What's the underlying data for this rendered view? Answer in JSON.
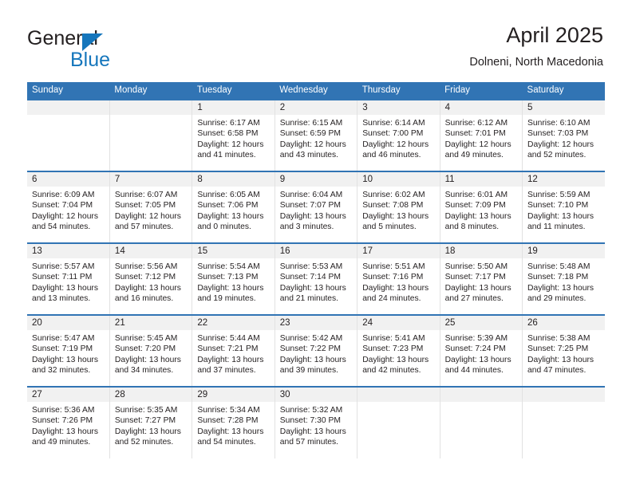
{
  "brand": {
    "name_part1": "General",
    "name_part2": "Blue",
    "accent_color": "#1576bc"
  },
  "header": {
    "title": "April 2025",
    "subtitle": "Dolneni, North Macedonia"
  },
  "theme": {
    "header_blue": "#3174b4",
    "daynum_bg": "#f1f1f1",
    "text": "#231f20"
  },
  "weekdays": [
    "Sunday",
    "Monday",
    "Tuesday",
    "Wednesday",
    "Thursday",
    "Friday",
    "Saturday"
  ],
  "labels": {
    "sunrise_prefix": "Sunrise: ",
    "sunset_prefix": "Sunset: ",
    "daylight_prefix": "Daylight: "
  },
  "weeks": [
    [
      {
        "day": "",
        "empty": true
      },
      {
        "day": "",
        "empty": true
      },
      {
        "day": "1",
        "sunrise": "Sunrise: 6:17 AM",
        "sunset": "Sunset: 6:58 PM",
        "daylight": "Daylight: 12 hours and 41 minutes."
      },
      {
        "day": "2",
        "sunrise": "Sunrise: 6:15 AM",
        "sunset": "Sunset: 6:59 PM",
        "daylight": "Daylight: 12 hours and 43 minutes."
      },
      {
        "day": "3",
        "sunrise": "Sunrise: 6:14 AM",
        "sunset": "Sunset: 7:00 PM",
        "daylight": "Daylight: 12 hours and 46 minutes."
      },
      {
        "day": "4",
        "sunrise": "Sunrise: 6:12 AM",
        "sunset": "Sunset: 7:01 PM",
        "daylight": "Daylight: 12 hours and 49 minutes."
      },
      {
        "day": "5",
        "sunrise": "Sunrise: 6:10 AM",
        "sunset": "Sunset: 7:03 PM",
        "daylight": "Daylight: 12 hours and 52 minutes."
      }
    ],
    [
      {
        "day": "6",
        "sunrise": "Sunrise: 6:09 AM",
        "sunset": "Sunset: 7:04 PM",
        "daylight": "Daylight: 12 hours and 54 minutes."
      },
      {
        "day": "7",
        "sunrise": "Sunrise: 6:07 AM",
        "sunset": "Sunset: 7:05 PM",
        "daylight": "Daylight: 12 hours and 57 minutes."
      },
      {
        "day": "8",
        "sunrise": "Sunrise: 6:05 AM",
        "sunset": "Sunset: 7:06 PM",
        "daylight": "Daylight: 13 hours and 0 minutes."
      },
      {
        "day": "9",
        "sunrise": "Sunrise: 6:04 AM",
        "sunset": "Sunset: 7:07 PM",
        "daylight": "Daylight: 13 hours and 3 minutes."
      },
      {
        "day": "10",
        "sunrise": "Sunrise: 6:02 AM",
        "sunset": "Sunset: 7:08 PM",
        "daylight": "Daylight: 13 hours and 5 minutes."
      },
      {
        "day": "11",
        "sunrise": "Sunrise: 6:01 AM",
        "sunset": "Sunset: 7:09 PM",
        "daylight": "Daylight: 13 hours and 8 minutes."
      },
      {
        "day": "12",
        "sunrise": "Sunrise: 5:59 AM",
        "sunset": "Sunset: 7:10 PM",
        "daylight": "Daylight: 13 hours and 11 minutes."
      }
    ],
    [
      {
        "day": "13",
        "sunrise": "Sunrise: 5:57 AM",
        "sunset": "Sunset: 7:11 PM",
        "daylight": "Daylight: 13 hours and 13 minutes."
      },
      {
        "day": "14",
        "sunrise": "Sunrise: 5:56 AM",
        "sunset": "Sunset: 7:12 PM",
        "daylight": "Daylight: 13 hours and 16 minutes."
      },
      {
        "day": "15",
        "sunrise": "Sunrise: 5:54 AM",
        "sunset": "Sunset: 7:13 PM",
        "daylight": "Daylight: 13 hours and 19 minutes."
      },
      {
        "day": "16",
        "sunrise": "Sunrise: 5:53 AM",
        "sunset": "Sunset: 7:14 PM",
        "daylight": "Daylight: 13 hours and 21 minutes."
      },
      {
        "day": "17",
        "sunrise": "Sunrise: 5:51 AM",
        "sunset": "Sunset: 7:16 PM",
        "daylight": "Daylight: 13 hours and 24 minutes."
      },
      {
        "day": "18",
        "sunrise": "Sunrise: 5:50 AM",
        "sunset": "Sunset: 7:17 PM",
        "daylight": "Daylight: 13 hours and 27 minutes."
      },
      {
        "day": "19",
        "sunrise": "Sunrise: 5:48 AM",
        "sunset": "Sunset: 7:18 PM",
        "daylight": "Daylight: 13 hours and 29 minutes."
      }
    ],
    [
      {
        "day": "20",
        "sunrise": "Sunrise: 5:47 AM",
        "sunset": "Sunset: 7:19 PM",
        "daylight": "Daylight: 13 hours and 32 minutes."
      },
      {
        "day": "21",
        "sunrise": "Sunrise: 5:45 AM",
        "sunset": "Sunset: 7:20 PM",
        "daylight": "Daylight: 13 hours and 34 minutes."
      },
      {
        "day": "22",
        "sunrise": "Sunrise: 5:44 AM",
        "sunset": "Sunset: 7:21 PM",
        "daylight": "Daylight: 13 hours and 37 minutes."
      },
      {
        "day": "23",
        "sunrise": "Sunrise: 5:42 AM",
        "sunset": "Sunset: 7:22 PM",
        "daylight": "Daylight: 13 hours and 39 minutes."
      },
      {
        "day": "24",
        "sunrise": "Sunrise: 5:41 AM",
        "sunset": "Sunset: 7:23 PM",
        "daylight": "Daylight: 13 hours and 42 minutes."
      },
      {
        "day": "25",
        "sunrise": "Sunrise: 5:39 AM",
        "sunset": "Sunset: 7:24 PM",
        "daylight": "Daylight: 13 hours and 44 minutes."
      },
      {
        "day": "26",
        "sunrise": "Sunrise: 5:38 AM",
        "sunset": "Sunset: 7:25 PM",
        "daylight": "Daylight: 13 hours and 47 minutes."
      }
    ],
    [
      {
        "day": "27",
        "sunrise": "Sunrise: 5:36 AM",
        "sunset": "Sunset: 7:26 PM",
        "daylight": "Daylight: 13 hours and 49 minutes."
      },
      {
        "day": "28",
        "sunrise": "Sunrise: 5:35 AM",
        "sunset": "Sunset: 7:27 PM",
        "daylight": "Daylight: 13 hours and 52 minutes."
      },
      {
        "day": "29",
        "sunrise": "Sunrise: 5:34 AM",
        "sunset": "Sunset: 7:28 PM",
        "daylight": "Daylight: 13 hours and 54 minutes."
      },
      {
        "day": "30",
        "sunrise": "Sunrise: 5:32 AM",
        "sunset": "Sunset: 7:30 PM",
        "daylight": "Daylight: 13 hours and 57 minutes."
      },
      {
        "day": "",
        "empty": true
      },
      {
        "day": "",
        "empty": true
      },
      {
        "day": "",
        "empty": true
      }
    ]
  ]
}
